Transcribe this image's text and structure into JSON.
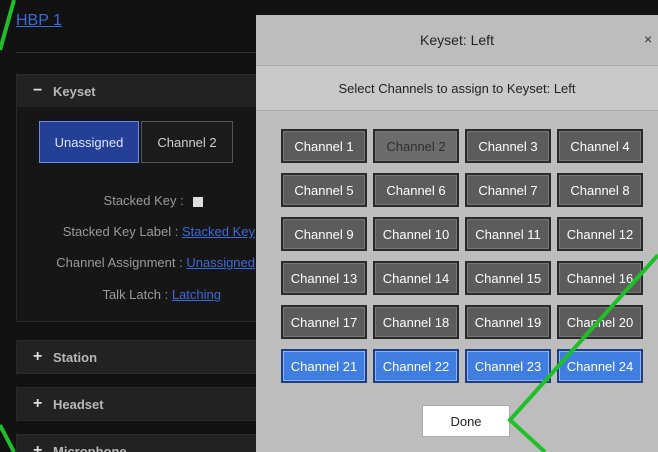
{
  "device": {
    "title": "HBP 1"
  },
  "keyset_section": {
    "label": "Keyset",
    "tabs": [
      "Unassigned",
      "Channel 2"
    ],
    "props": {
      "stacked_key_label": "Stacked Key :",
      "stacked_key_label_label": "Stacked Key Label :",
      "stacked_key_label_value": "Stacked Key",
      "channel_assignment_label": "Channel Assignment :",
      "channel_assignment_value": "Unassigned",
      "talk_latch_label": "Talk Latch :",
      "talk_latch_value": "Latching"
    }
  },
  "sections": [
    "Station",
    "Headset",
    "Microphone"
  ],
  "modal": {
    "title": "Keyset: Left",
    "close": "×",
    "subtitle": "Select Channels to assign to Keyset: Left",
    "done": "Done",
    "channels": [
      {
        "label": "Channel 1",
        "state": "normal"
      },
      {
        "label": "Channel 2",
        "state": "disabled"
      },
      {
        "label": "Channel 3",
        "state": "normal"
      },
      {
        "label": "Channel 4",
        "state": "normal"
      },
      {
        "label": "Channel 5",
        "state": "normal"
      },
      {
        "label": "Channel 6",
        "state": "normal"
      },
      {
        "label": "Channel 7",
        "state": "normal"
      },
      {
        "label": "Channel 8",
        "state": "normal"
      },
      {
        "label": "Channel 9",
        "state": "normal"
      },
      {
        "label": "Channel 10",
        "state": "normal"
      },
      {
        "label": "Channel 11",
        "state": "normal"
      },
      {
        "label": "Channel 12",
        "state": "normal"
      },
      {
        "label": "Channel 13",
        "state": "normal"
      },
      {
        "label": "Channel 14",
        "state": "normal"
      },
      {
        "label": "Channel 15",
        "state": "normal"
      },
      {
        "label": "Channel 16",
        "state": "normal"
      },
      {
        "label": "Channel 17",
        "state": "normal"
      },
      {
        "label": "Channel 18",
        "state": "normal"
      },
      {
        "label": "Channel 19",
        "state": "normal"
      },
      {
        "label": "Channel 20",
        "state": "normal"
      },
      {
        "label": "Channel 21",
        "state": "selected"
      },
      {
        "label": "Channel 22",
        "state": "selected"
      },
      {
        "label": "Channel 23",
        "state": "selected"
      },
      {
        "label": "Channel 24",
        "state": "selected"
      }
    ]
  },
  "colors": {
    "link": "#3d6ad6",
    "selected_channel": "#3f7de0",
    "annotation": "#1fbf2a"
  }
}
